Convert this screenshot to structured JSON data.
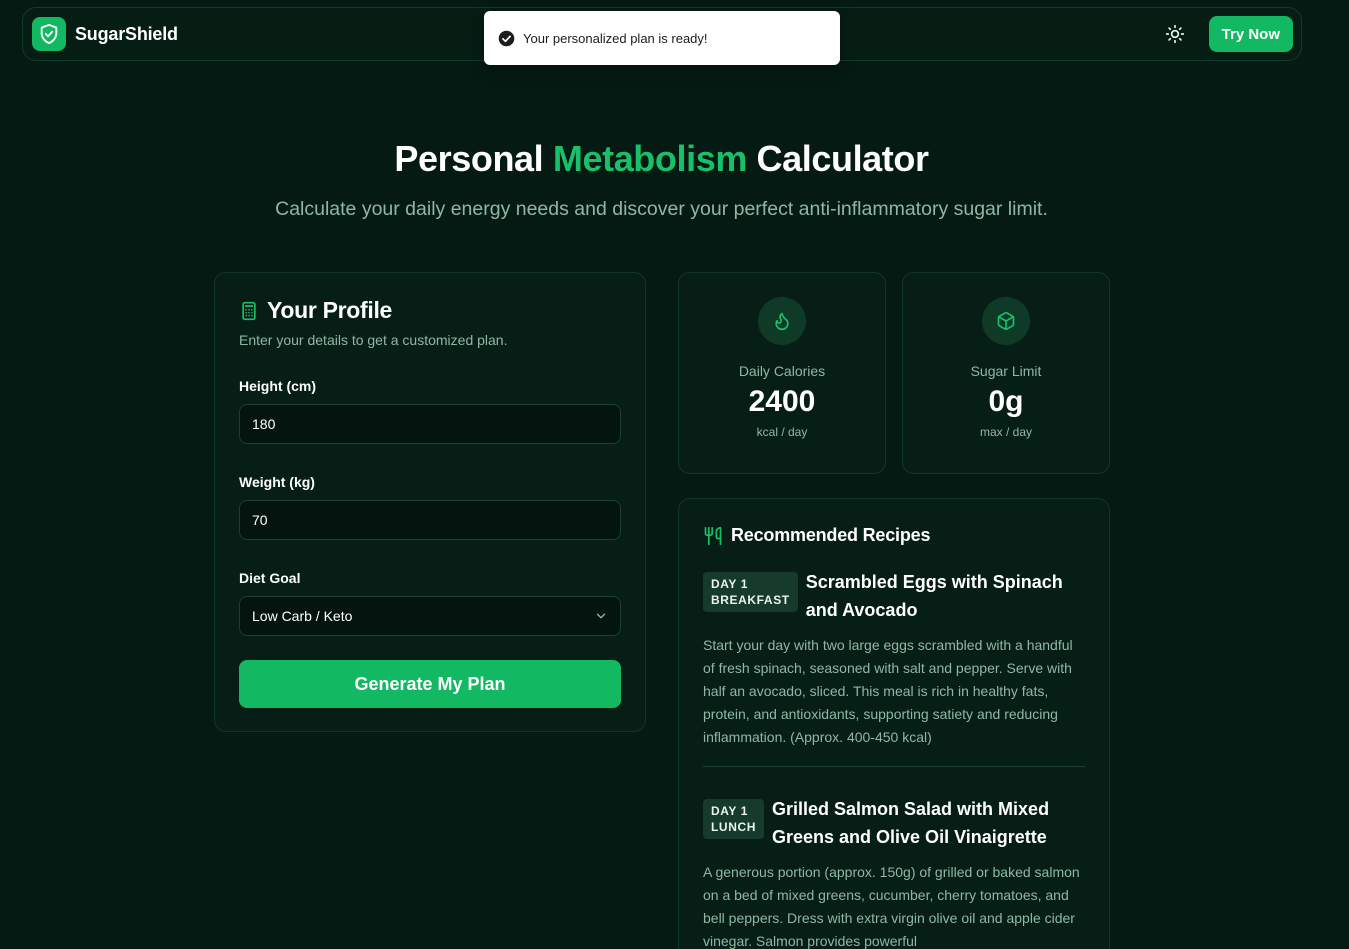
{
  "navbar": {
    "brand": "SugarShield",
    "cta_label": "Try Now"
  },
  "toast": {
    "message": "Your personalized plan is ready!"
  },
  "hero": {
    "title_prefix": "Personal",
    "title_accent": "Metabolism",
    "title_suffix": "Calculator",
    "subtitle": "Calculate your daily energy needs and discover your perfect anti-inflammatory sugar limit."
  },
  "profile": {
    "title": "Your Profile",
    "description": "Enter your details to get a customized plan.",
    "height_label": "Height (cm)",
    "height_value": "180",
    "weight_label": "Weight (kg)",
    "weight_value": "70",
    "goal_label": "Diet Goal",
    "goal_value": "Low Carb / Keto",
    "submit_label": "Generate My Plan"
  },
  "stats": {
    "calories": {
      "label": "Daily Calories",
      "value": "2400",
      "unit": "kcal / day"
    },
    "sugar": {
      "label": "Sugar Limit",
      "value": "0g",
      "unit": "max / day"
    }
  },
  "recipes": {
    "title": "Recommended Recipes",
    "items": [
      {
        "day": "DAY 1",
        "meal": "BREAKFAST",
        "name_line1": "Scrambled Eggs with Spinach",
        "name_line2": "and Avocado",
        "description": "Start your day with two large eggs scrambled with a handful of fresh spinach, seasoned with salt and pepper. Serve with half an avocado, sliced. This meal is rich in healthy fats, protein, and antioxidants, supporting satiety and reducing inflammation. (Approx. 400-450 kcal)"
      },
      {
        "day": "DAY 1",
        "meal": "LUNCH",
        "name_line1": "Grilled Salmon Salad with Mixed",
        "name_line2": "Greens and Olive Oil Vinaigrette",
        "description": "A generous portion (approx. 150g) of grilled or baked salmon on a bed of mixed greens, cucumber, cherry tomatoes, and bell peppers. Dress with extra virgin olive oil and apple cider vinegar. Salmon provides powerful"
      }
    ]
  },
  "colors": {
    "background": "#051a12",
    "accent": "#12b862",
    "card": "#061e15",
    "muted_text": "#8fb8a4"
  }
}
